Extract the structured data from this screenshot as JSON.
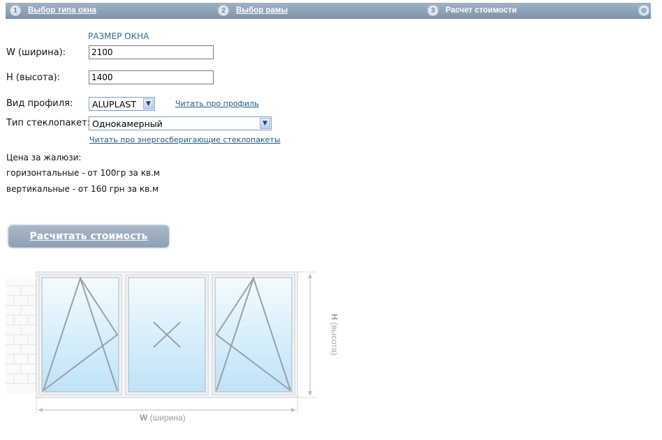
{
  "steps": [
    {
      "num": "1",
      "label": "Выбор типа окна"
    },
    {
      "num": "2",
      "label": "Выбор рамы"
    },
    {
      "num": "3",
      "label": "Расчет стоимости"
    }
  ],
  "size_section": {
    "title": "РАЗМЕР ОКНА"
  },
  "width": {
    "label": "W (ширина):",
    "value": "2100"
  },
  "height": {
    "label": "H (высота):",
    "value": "1400"
  },
  "profile": {
    "label": "Вид профиля:",
    "selected": "ALUPLAST",
    "link": "Читать про профиль"
  },
  "glass": {
    "label": "Тип стеклопакет:",
    "selected": "Однокамерный",
    "link": "Читать про энергосберигающие стеклопакеты"
  },
  "blinds": {
    "title": "Цена за жалюзи:",
    "horizontal": "горизонтальные - от 100гр за кв.м",
    "vertical": "вертикальные - от 160 грн за кв.м"
  },
  "calculate_button": "Расчитать стоимость",
  "diagram": {
    "h_bold": "H",
    "h_label": "(высота)",
    "w_bold": "W",
    "w_label": "(ширина)"
  },
  "colors": {
    "bar": "#8ea3b8",
    "link": "#1b5a8c",
    "title": "#2f6b9a",
    "glass": "#d4ecf9"
  }
}
